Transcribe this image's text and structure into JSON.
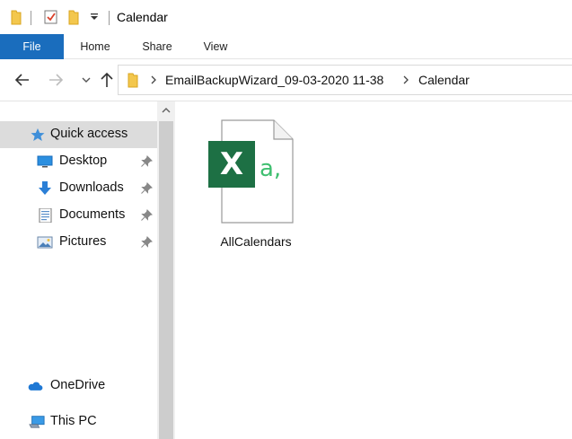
{
  "window": {
    "title": "Calendar"
  },
  "quick_access_toolbar": {
    "icons": [
      "folder-icon",
      "properties-icon",
      "new-folder-icon",
      "customize-toolbar-dropdown-icon"
    ]
  },
  "ribbon": {
    "tabs": [
      {
        "label": "File",
        "active": true
      },
      {
        "label": "Home"
      },
      {
        "label": "Share"
      },
      {
        "label": "View"
      }
    ]
  },
  "navigation": {
    "breadcrumb": [
      "EmailBackupWizard_09-03-2020 11-38",
      "Calendar"
    ]
  },
  "nav_pane": {
    "items": [
      {
        "label": "Quick access",
        "icon": "star-icon",
        "selected": true
      },
      {
        "label": "Desktop",
        "icon": "desktop-icon",
        "pinned": true
      },
      {
        "label": "Downloads",
        "icon": "download-arrow-icon",
        "pinned": true
      },
      {
        "label": "Documents",
        "icon": "documents-icon",
        "pinned": true
      },
      {
        "label": "Pictures",
        "icon": "pictures-icon",
        "pinned": true
      },
      {
        "label": "OneDrive",
        "icon": "cloud-icon"
      },
      {
        "label": "This PC",
        "icon": "computer-icon"
      }
    ]
  },
  "files": [
    {
      "name": "AllCalendars",
      "icon": "excel-csv-icon",
      "icon_letter": "X",
      "icon_sub": "a,"
    }
  ],
  "colors": {
    "file_tab": "#1a6dbd",
    "excel_green": "#1d7044",
    "csv_green": "#3fbf70",
    "selected_bg": "#dcdcdc",
    "folder_yellow": "#f3c74d"
  }
}
